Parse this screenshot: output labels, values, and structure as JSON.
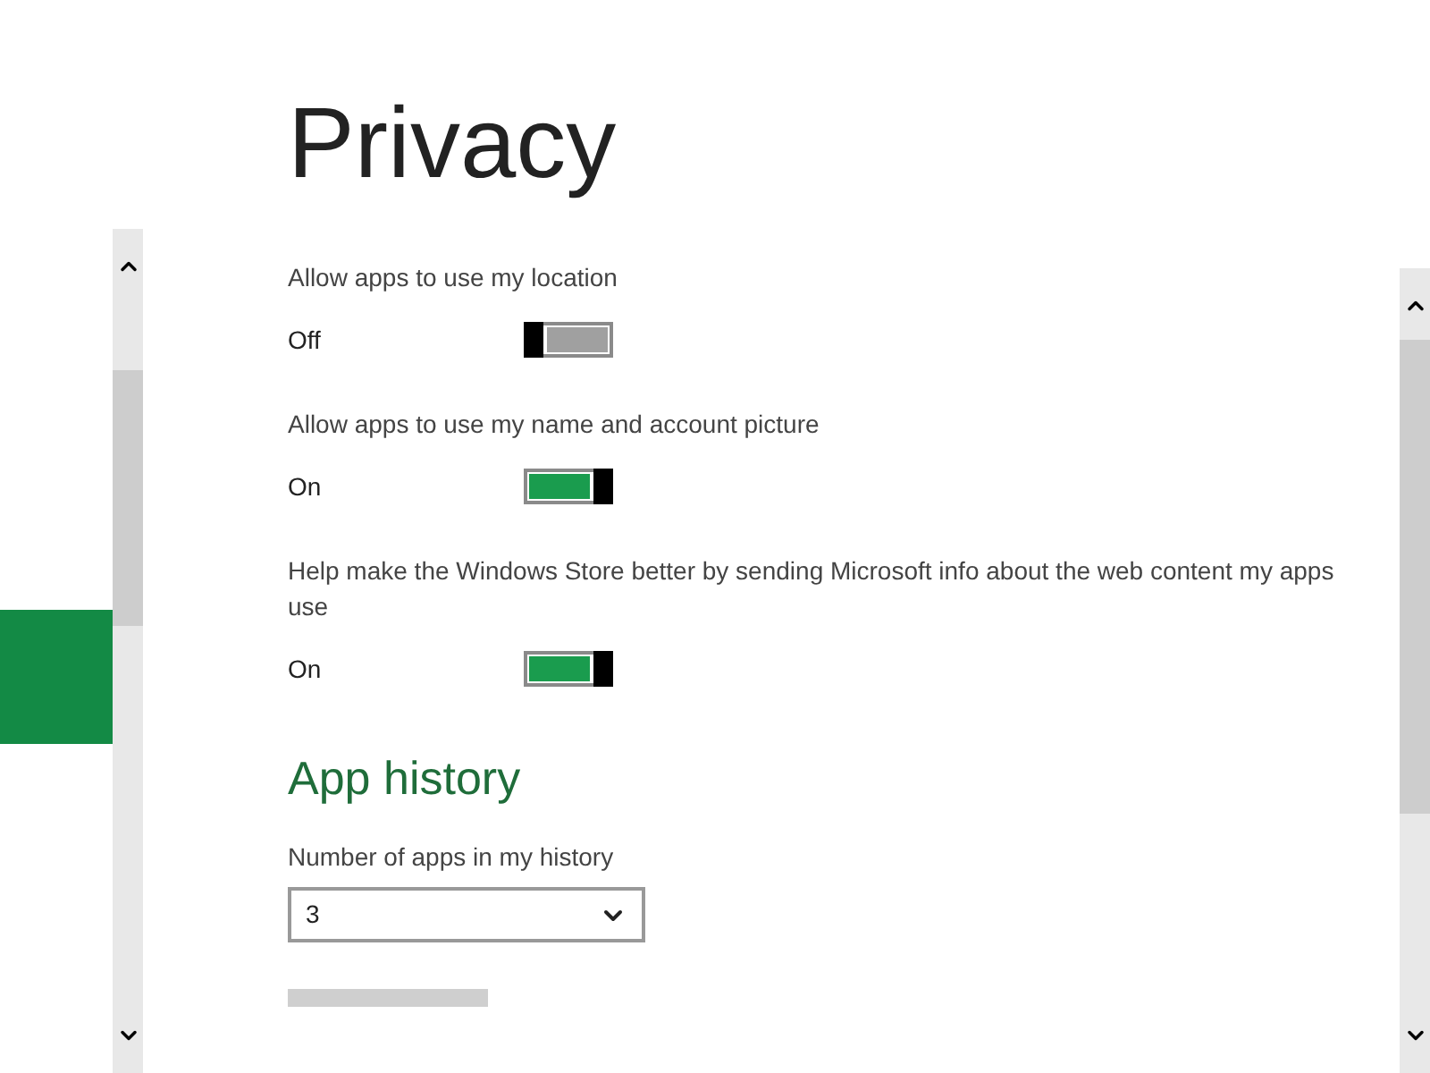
{
  "title": "Privacy",
  "settings": [
    {
      "label": "Allow apps to use my location",
      "state_text": "Off",
      "on": false
    },
    {
      "label": "Allow apps to use my name and account picture",
      "state_text": "On",
      "on": true
    },
    {
      "label": "Help make the Windows Store better by sending Microsoft info about the web content my apps use",
      "state_text": "On",
      "on": true
    }
  ],
  "section": {
    "heading": "App history",
    "field_label": "Number of apps in my history",
    "dropdown_value": "3"
  }
}
